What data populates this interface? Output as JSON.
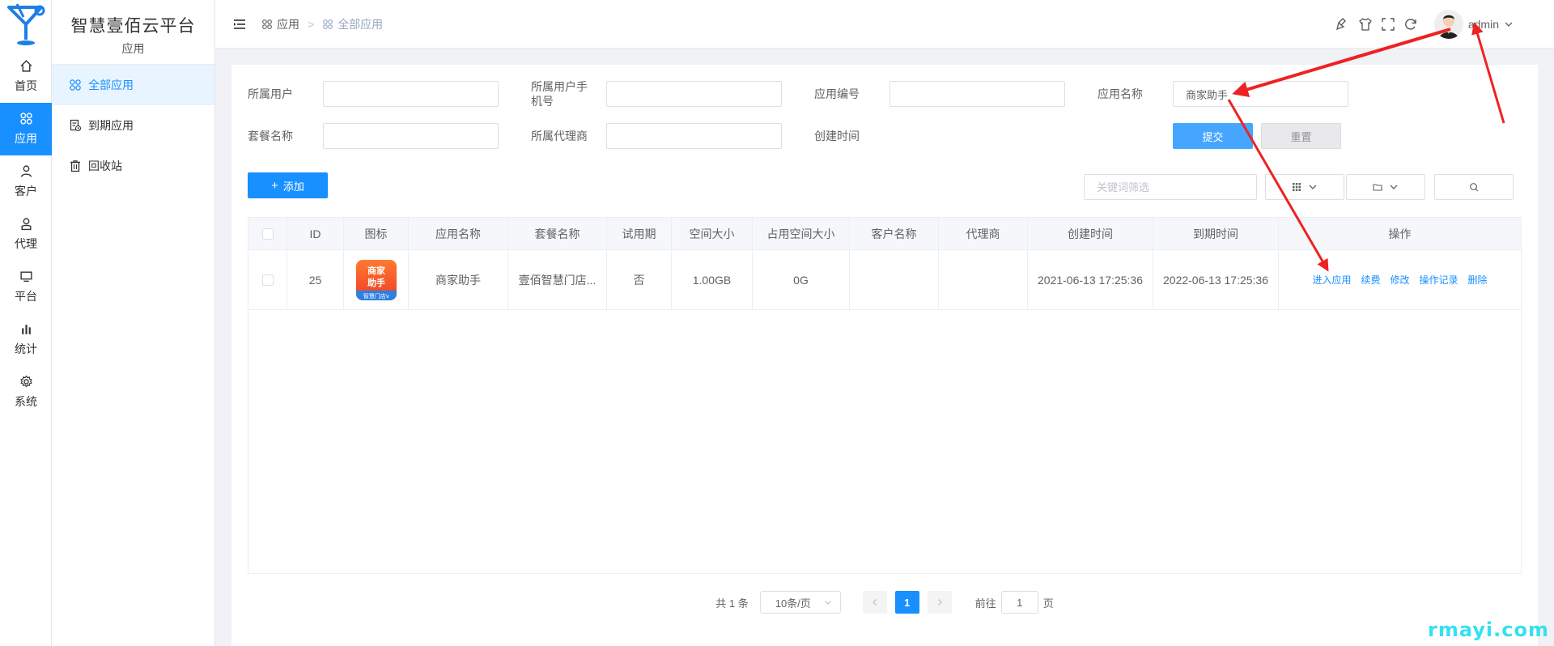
{
  "rail": {
    "items": [
      {
        "label": "首页",
        "icon": "home-icon"
      },
      {
        "label": "应用",
        "icon": "apps-icon",
        "active": true
      },
      {
        "label": "客户",
        "icon": "user-icon"
      },
      {
        "label": "代理",
        "icon": "agent-icon"
      },
      {
        "label": "平台",
        "icon": "monitor-icon"
      },
      {
        "label": "统计",
        "icon": "bar-chart-icon"
      },
      {
        "label": "系统",
        "icon": "gear-icon"
      }
    ]
  },
  "sidebar": {
    "title": "智慧壹佰云平台",
    "subtitle": "应用",
    "items": [
      {
        "label": "全部应用",
        "icon": "apps-icon",
        "active": true
      },
      {
        "label": "到期应用",
        "icon": "expire-doc-icon"
      },
      {
        "label": "回收站",
        "icon": "trash-icon"
      }
    ]
  },
  "header": {
    "breadcrumb": [
      "应用",
      "全部应用"
    ],
    "separator": ">",
    "username": "admin"
  },
  "filters": {
    "owner_user_label": "所属用户",
    "owner_phone_label": "所属用户手机号",
    "app_no_label": "应用编号",
    "app_name_label": "应用名称",
    "app_name_value": "商家助手",
    "package_label": "套餐名称",
    "agent_label": "所属代理商",
    "created_label": "创建时间",
    "submit_label": "提交",
    "reset_label": "重置"
  },
  "toolbar": {
    "add_label": "添加",
    "keyword_placeholder": "关键词筛选"
  },
  "table": {
    "columns": [
      "ID",
      "图标",
      "应用名称",
      "套餐名称",
      "试用期",
      "空间大小",
      "占用空间大小",
      "客户名称",
      "代理商",
      "创建时间",
      "到期时间",
      "操作"
    ],
    "rows": [
      {
        "id": "25",
        "icon_lines": [
          "商家",
          "助手",
          "智慧门店v"
        ],
        "app_name": "商家助手",
        "package": "壹佰智慧门店...",
        "trial": "否",
        "space": "1.00GB",
        "used": "0G",
        "customer": "",
        "agent": "",
        "created": "2021-06-13 17:25:36",
        "expires": "2022-06-13 17:25:36",
        "actions": [
          "进入应用",
          "续费",
          "修改",
          "操作记录",
          "删除"
        ]
      }
    ]
  },
  "pagination": {
    "total": "共 1 条",
    "page_size": "10条/页",
    "current": "1",
    "goto_prefix": "前往",
    "goto_value": "1",
    "goto_suffix": "页"
  },
  "watermark": "rmayi.com",
  "colors": {
    "primary": "#1890ff",
    "annotation": "#ee2222"
  }
}
